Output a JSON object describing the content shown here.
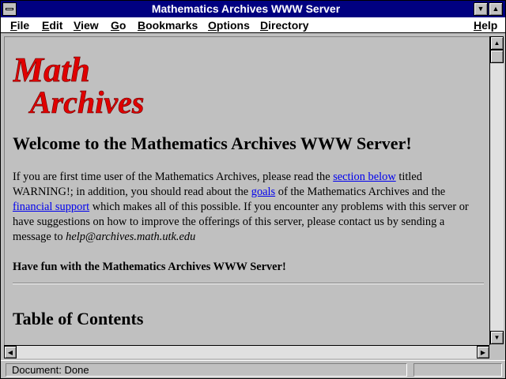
{
  "window": {
    "title": "Mathematics Archives WWW Server"
  },
  "menu": {
    "items": [
      {
        "ul": "F",
        "rest": "ile"
      },
      {
        "ul": "E",
        "rest": "dit"
      },
      {
        "ul": "V",
        "rest": "iew"
      },
      {
        "ul": "G",
        "rest": "o"
      },
      {
        "ul": "B",
        "rest": "ookmarks"
      },
      {
        "ul": "O",
        "rest": "ptions"
      },
      {
        "ul": "D",
        "rest": "irectory"
      },
      {
        "ul": "H",
        "rest": "elp"
      }
    ]
  },
  "page": {
    "logo": {
      "line1": "Math",
      "line2": "Archives"
    },
    "heading": "Welcome to the Mathematics Archives WWW Server!",
    "intro": {
      "t1": "If you are first time user of the Mathematics Archives, please read the ",
      "link1": "section below",
      "t2": " titled WARNING!; in addition, you should read about the ",
      "link2": "goals",
      "t3": " of the Mathematics Archives and the ",
      "link3": "financial support",
      "t4": " which makes all of this possible. If you encounter any problems with this server or have suggestions on how to improve the offerings of this server, please contact us by sending a message to ",
      "email": "help@archives.math.utk.edu"
    },
    "fun": "Have fun with the Mathematics Archives WWW Server!",
    "toc_heading": "Table of Contents"
  },
  "status": {
    "text": "Document: Done"
  },
  "colors": {
    "titlebar": "#000080",
    "link": "#0000ee",
    "logo": "#e00000"
  },
  "icons": {
    "system_menu": "system-menu-icon",
    "minimize": "minimize-arrow-icon",
    "maximize": "maximize-arrow-icon",
    "scroll_up": "arrow-up-icon",
    "scroll_down": "arrow-down-icon",
    "scroll_left": "arrow-left-icon",
    "scroll_right": "arrow-right-icon"
  }
}
